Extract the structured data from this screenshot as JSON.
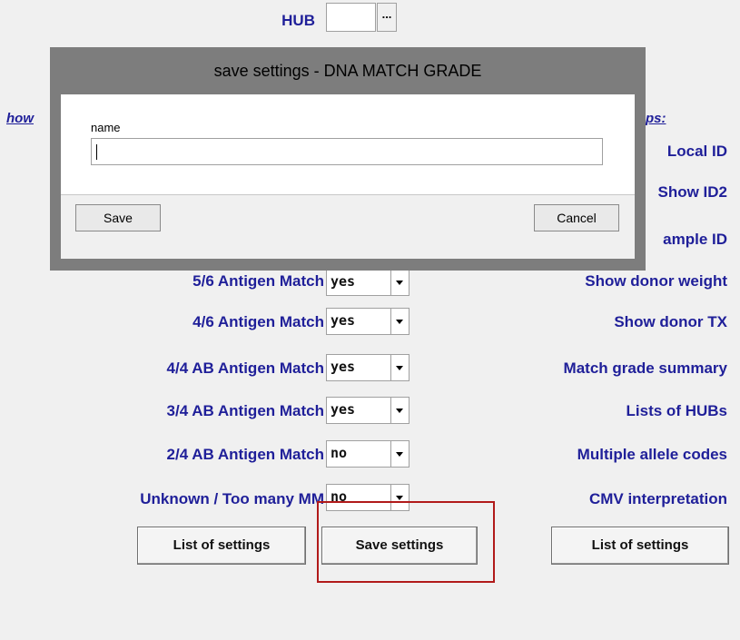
{
  "hub": {
    "label": "HUB",
    "ellipsis": "..."
  },
  "dialog": {
    "title": "save settings - DNA MATCH GRADE",
    "name_label": "name",
    "name_value": "",
    "save_label": "Save",
    "cancel_label": "Cancel"
  },
  "partial": {
    "left_link": "how",
    "right_link": "ps:",
    "local_id": "Local ID",
    "show_id2": "Show ID2",
    "sample_id": "ample ID"
  },
  "left_rows": [
    {
      "label": "5/6 Antigen Match",
      "value": "yes"
    },
    {
      "label": "4/6 Antigen Match",
      "value": "yes"
    },
    {
      "label": "4/4 AB Antigen Match",
      "value": "yes"
    },
    {
      "label": "3/4 AB Antigen Match",
      "value": "yes"
    },
    {
      "label": "2/4 AB Antigen Match",
      "value": "no"
    },
    {
      "label": "Unknown / Too many MM",
      "value": "no"
    }
  ],
  "right_rows": [
    "Show donor weight",
    "Show donor TX",
    "Match grade summary",
    "Lists of HUBs",
    "Multiple allele codes",
    "CMV interpretation"
  ],
  "buttons": {
    "list_settings_left": "List of settings",
    "save_settings": "Save settings",
    "list_settings_right": "List of settings"
  },
  "colors": {
    "label_blue": "#1f1f99",
    "highlight_red": "#b11a1a"
  }
}
